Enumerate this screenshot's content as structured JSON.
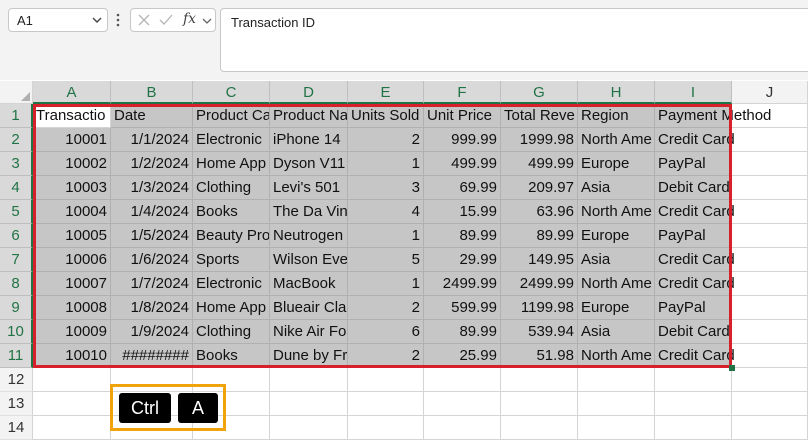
{
  "formula_bar": {
    "name_box": "A1",
    "fx_label": "fx",
    "formula": "Transaction ID"
  },
  "columns": [
    "A",
    "B",
    "C",
    "D",
    "E",
    "F",
    "G",
    "H",
    "I",
    "J"
  ],
  "rows": [
    "1",
    "2",
    "3",
    "4",
    "5",
    "6",
    "7",
    "8",
    "9",
    "10",
    "11",
    "12",
    "13",
    "14"
  ],
  "headers": [
    "Transaction ID",
    "Date",
    "Product Category",
    "Product Name",
    "Units Sold",
    "Unit Price",
    "Total Revenue",
    "Region",
    "Payment Method"
  ],
  "header_display": {
    "A": "Transactio",
    "B": "Date",
    "C": "Product Ca",
    "D": "Product Na",
    "E": "Units Sold",
    "F": "Unit Price",
    "G": "Total Reve",
    "H": "Region",
    "I": "Payment Method"
  },
  "data_rows": [
    [
      "10001",
      "1/1/2024",
      "Electronic",
      "iPhone 14",
      "2",
      "999.99",
      "1999.98",
      "North Ame",
      "Credit Card"
    ],
    [
      "10002",
      "1/2/2024",
      "Home App",
      "Dyson V11",
      "1",
      "499.99",
      "499.99",
      "Europe",
      "PayPal"
    ],
    [
      "10003",
      "1/3/2024",
      "Clothing",
      "Levi's 501",
      "3",
      "69.99",
      "209.97",
      "Asia",
      "Debit Card"
    ],
    [
      "10004",
      "1/4/2024",
      "Books",
      "The Da Vin",
      "4",
      "15.99",
      "63.96",
      "North Ame",
      "Credit Card"
    ],
    [
      "10005",
      "1/5/2024",
      "Beauty Pro",
      "Neutrogen",
      "1",
      "89.99",
      "89.99",
      "Europe",
      "PayPal"
    ],
    [
      "10006",
      "1/6/2024",
      "Sports",
      "Wilson Eve",
      "5",
      "29.99",
      "149.95",
      "Asia",
      "Credit Card"
    ],
    [
      "10007",
      "1/7/2024",
      "Electronic",
      "MacBook",
      "1",
      "2499.99",
      "2499.99",
      "North Ame",
      "Credit Card"
    ],
    [
      "10008",
      "1/8/2024",
      "Home App",
      "Blueair Cla",
      "2",
      "599.99",
      "1199.98",
      "Europe",
      "PayPal"
    ],
    [
      "10009",
      "1/9/2024",
      "Clothing",
      "Nike Air Fo",
      "6",
      "89.99",
      "539.94",
      "Asia",
      "Debit Card"
    ],
    [
      "10010",
      "########",
      "Books",
      "Dune by Fr",
      "2",
      "25.99",
      "51.98",
      "North Ame",
      "Credit Card"
    ]
  ],
  "keyboard_hint": {
    "key1": "Ctrl",
    "key2": "A"
  },
  "colors": {
    "selection_border": "#d6202a",
    "header_accent": "#217346",
    "key_highlight": "#f0a30a"
  }
}
